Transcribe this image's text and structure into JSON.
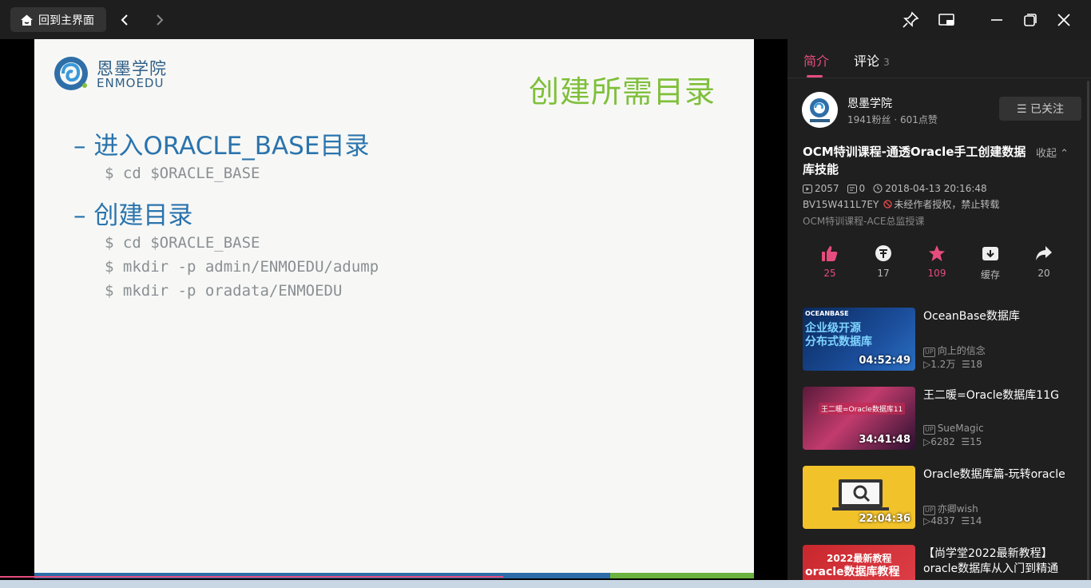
{
  "titlebar": {
    "home_label": "回到主界面"
  },
  "slide": {
    "logo_cn": "恩墨学院",
    "logo_en": "ENMOEDU",
    "title": "创建所需目录",
    "bullet1": "– 进入ORACLE_BASE目录",
    "code1": "$ cd $ORACLE_BASE",
    "bullet2": "– 创建目录",
    "code2": [
      "$ cd $ORACLE_BASE",
      "$ mkdir -p admin/ENMOEDU/adump",
      "$ mkdir -p oradata/ENMOEDU"
    ]
  },
  "tabs": {
    "intro": "简介",
    "comments": "评论",
    "comment_count": "3"
  },
  "uploader": {
    "name": "恩墨学院",
    "stats": "1941粉丝 · 601点赞",
    "follow_label": "☰ 已关注"
  },
  "video": {
    "title": "OCM特训课程-通透Oracle手工创建数据库技能",
    "collapse": "收起",
    "views": "2057",
    "danmaku": "0",
    "date": "2018-04-13 20:16:48",
    "bvid": "BV15W411L7EY",
    "copyright": "未经作者授权，禁止转载",
    "series": "OCM特训课程-ACE总监授课"
  },
  "actions": [
    {
      "label": "25",
      "color": "#e64d7e"
    },
    {
      "label": "17",
      "color": "#bbbbbb"
    },
    {
      "label": "109",
      "color": "#e64d7e"
    },
    {
      "label": "缓存",
      "color": "#bbbbbb"
    },
    {
      "label": "20",
      "color": "#bbbbbb"
    }
  ],
  "recommendations": [
    {
      "title": "OceanBase数据库",
      "uploader": "向上的信念",
      "views": "1.2万",
      "danmaku": "18",
      "duration": "04:52:49",
      "thumb_text": "企业级开源\n分布式数据库",
      "thumb_brand": "OCEANBASE"
    },
    {
      "title": "王二暖=Oracle数据库11G",
      "uploader": "SueMagic",
      "views": "6282",
      "danmaku": "15",
      "duration": "34:41:48",
      "thumb_text": "王二暖=Oracle数据库11"
    },
    {
      "title": "Oracle数据库篇-玩转oracle",
      "uploader": "亦卿wish",
      "views": "4837",
      "danmaku": "14",
      "duration": "22:04:36"
    },
    {
      "title": "【尚学堂2022最新教程】oracle数据库从入门到精通",
      "thumb_line1": "2022最新教程",
      "thumb_line2": "oracle数据库教程"
    }
  ]
}
